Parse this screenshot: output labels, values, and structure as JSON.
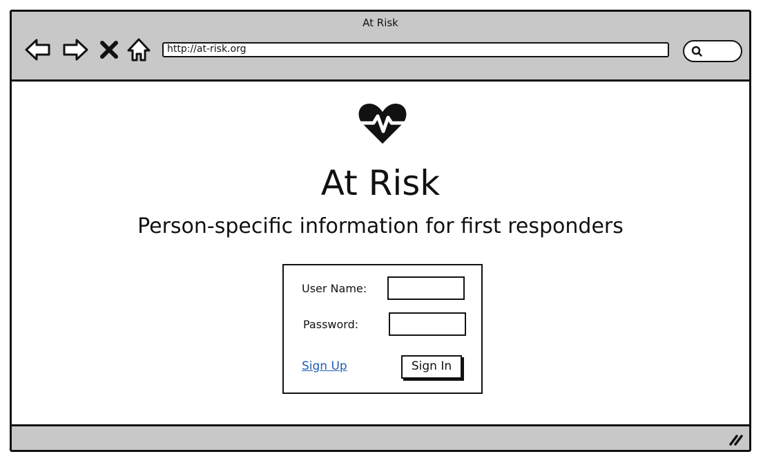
{
  "window": {
    "title": "At Risk"
  },
  "toolbar": {
    "back_icon": "back-arrow-icon",
    "forward_icon": "forward-arrow-icon",
    "stop_icon": "close-x-icon",
    "home_icon": "home-icon",
    "url": "http://at-risk.org",
    "search_icon": "search-icon"
  },
  "page": {
    "logo_icon": "heart-pulse-icon",
    "title": "At Risk",
    "tagline": "Person-specific information for first responders"
  },
  "login": {
    "username_label": "User Name:",
    "username_value": "",
    "password_label": "Password:",
    "password_value": "",
    "signup_link": "Sign Up",
    "signin_button": "Sign In"
  },
  "colors": {
    "chrome": "#c8c8c8",
    "border": "#111111",
    "link": "#1f5fb0"
  }
}
